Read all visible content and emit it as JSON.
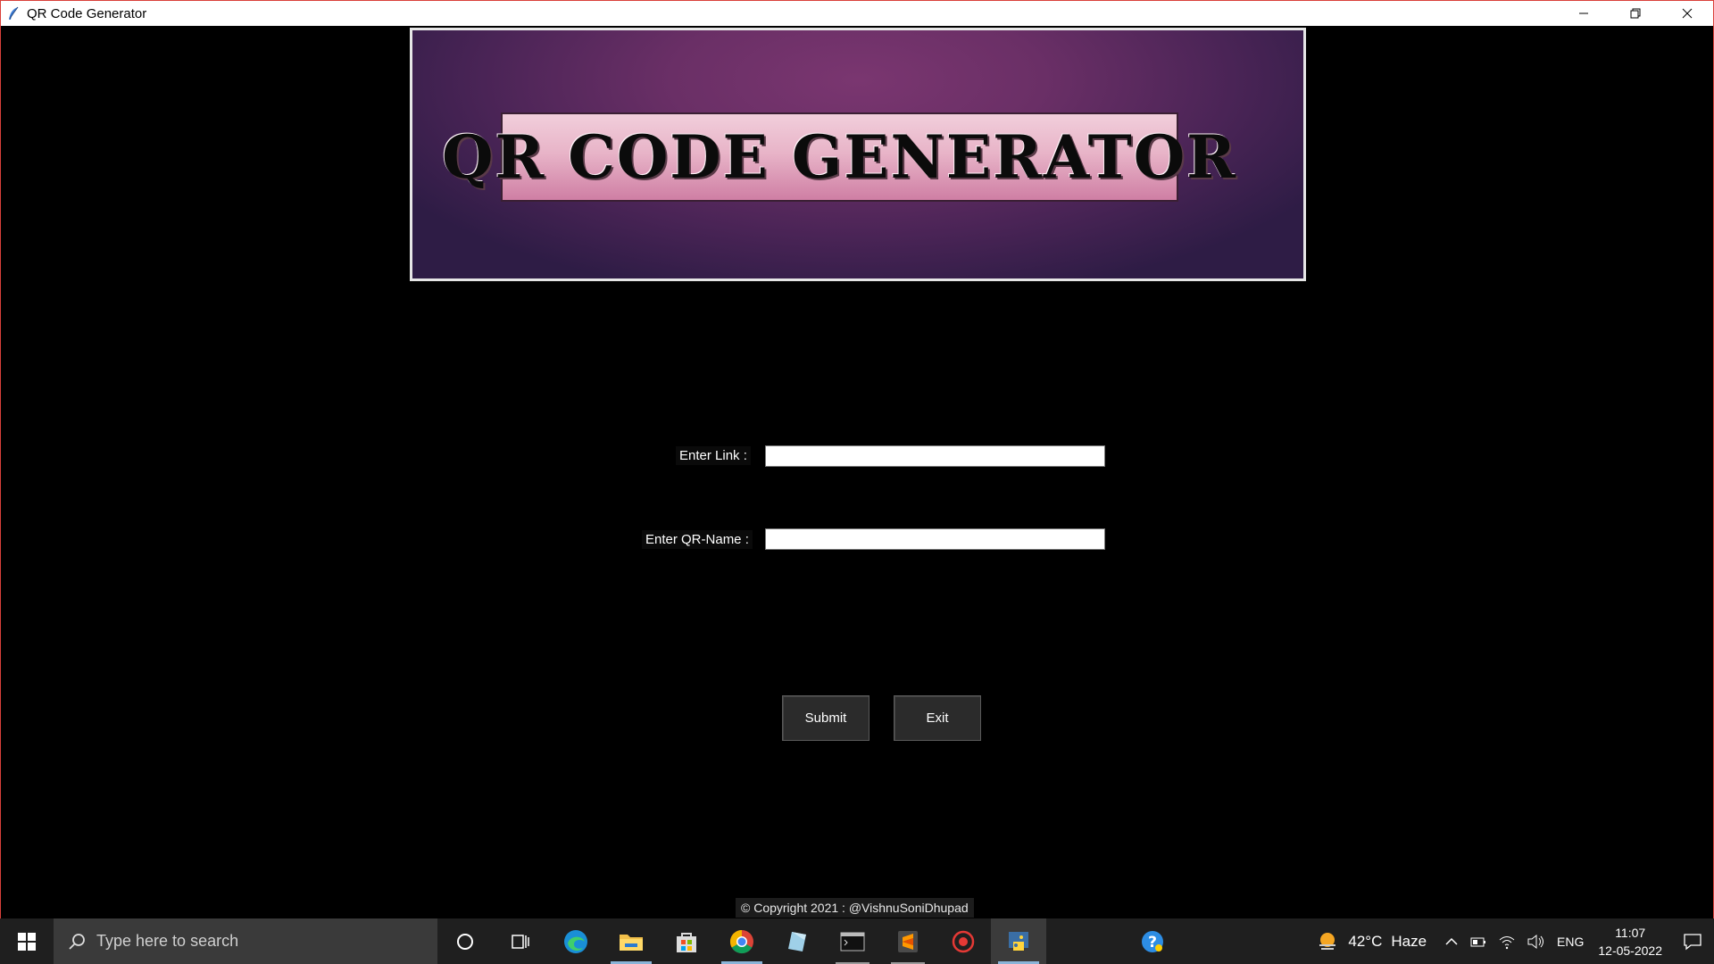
{
  "window": {
    "title": "QR Code Generator"
  },
  "banner": {
    "heading": "QR CODE GENERATOR"
  },
  "form": {
    "link_label": "Enter Link :",
    "link_value": "",
    "name_label": "Enter QR-Name :",
    "name_value": ""
  },
  "buttons": {
    "submit": "Submit",
    "exit": "Exit"
  },
  "footer": {
    "copyright": "© Copyright 2021 : @VishnuSoniDhupad"
  },
  "taskbar": {
    "search_placeholder": "Type here to search",
    "pinned": [
      "cortana-icon",
      "task-view-icon",
      "edge-icon",
      "file-explorer-icon",
      "store-icon",
      "chrome-icon",
      "notes-icon",
      "terminal-icon",
      "sublime-icon",
      "recorder-icon",
      "python-icon"
    ],
    "weather": {
      "temp": "42°C",
      "condition": "Haze"
    },
    "language": "ENG",
    "time": "11:07",
    "date": "12-05-2022"
  }
}
